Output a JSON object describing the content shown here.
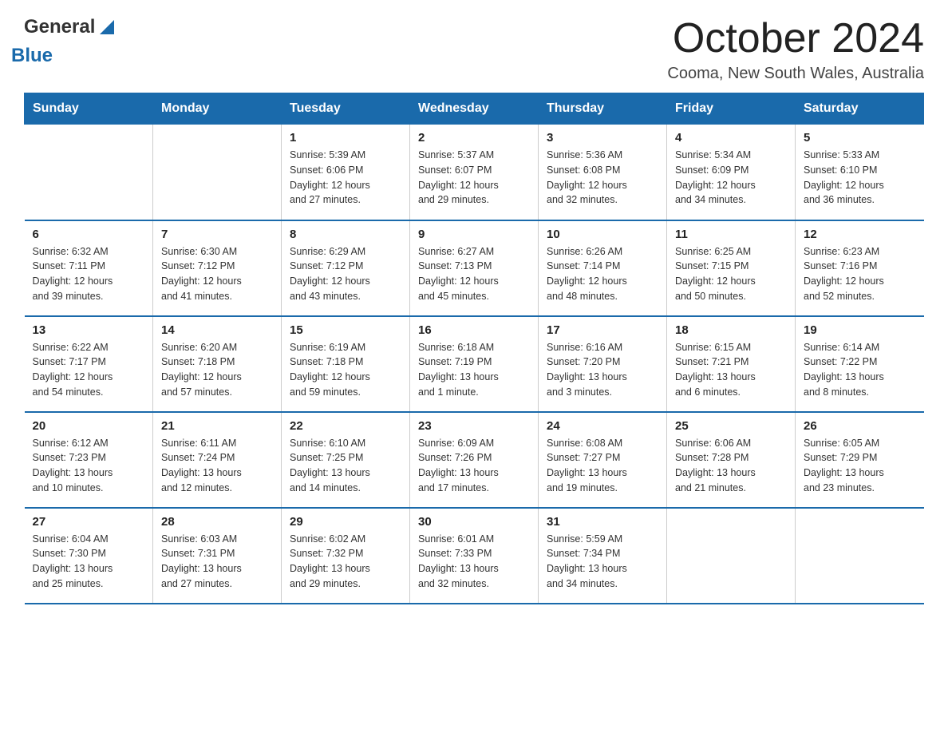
{
  "logo": {
    "general": "General",
    "blue": "Blue"
  },
  "title": "October 2024",
  "location": "Cooma, New South Wales, Australia",
  "days_of_week": [
    "Sunday",
    "Monday",
    "Tuesday",
    "Wednesday",
    "Thursday",
    "Friday",
    "Saturday"
  ],
  "weeks": [
    [
      {
        "day": "",
        "info": ""
      },
      {
        "day": "",
        "info": ""
      },
      {
        "day": "1",
        "info": "Sunrise: 5:39 AM\nSunset: 6:06 PM\nDaylight: 12 hours\nand 27 minutes."
      },
      {
        "day": "2",
        "info": "Sunrise: 5:37 AM\nSunset: 6:07 PM\nDaylight: 12 hours\nand 29 minutes."
      },
      {
        "day": "3",
        "info": "Sunrise: 5:36 AM\nSunset: 6:08 PM\nDaylight: 12 hours\nand 32 minutes."
      },
      {
        "day": "4",
        "info": "Sunrise: 5:34 AM\nSunset: 6:09 PM\nDaylight: 12 hours\nand 34 minutes."
      },
      {
        "day": "5",
        "info": "Sunrise: 5:33 AM\nSunset: 6:10 PM\nDaylight: 12 hours\nand 36 minutes."
      }
    ],
    [
      {
        "day": "6",
        "info": "Sunrise: 6:32 AM\nSunset: 7:11 PM\nDaylight: 12 hours\nand 39 minutes."
      },
      {
        "day": "7",
        "info": "Sunrise: 6:30 AM\nSunset: 7:12 PM\nDaylight: 12 hours\nand 41 minutes."
      },
      {
        "day": "8",
        "info": "Sunrise: 6:29 AM\nSunset: 7:12 PM\nDaylight: 12 hours\nand 43 minutes."
      },
      {
        "day": "9",
        "info": "Sunrise: 6:27 AM\nSunset: 7:13 PM\nDaylight: 12 hours\nand 45 minutes."
      },
      {
        "day": "10",
        "info": "Sunrise: 6:26 AM\nSunset: 7:14 PM\nDaylight: 12 hours\nand 48 minutes."
      },
      {
        "day": "11",
        "info": "Sunrise: 6:25 AM\nSunset: 7:15 PM\nDaylight: 12 hours\nand 50 minutes."
      },
      {
        "day": "12",
        "info": "Sunrise: 6:23 AM\nSunset: 7:16 PM\nDaylight: 12 hours\nand 52 minutes."
      }
    ],
    [
      {
        "day": "13",
        "info": "Sunrise: 6:22 AM\nSunset: 7:17 PM\nDaylight: 12 hours\nand 54 minutes."
      },
      {
        "day": "14",
        "info": "Sunrise: 6:20 AM\nSunset: 7:18 PM\nDaylight: 12 hours\nand 57 minutes."
      },
      {
        "day": "15",
        "info": "Sunrise: 6:19 AM\nSunset: 7:18 PM\nDaylight: 12 hours\nand 59 minutes."
      },
      {
        "day": "16",
        "info": "Sunrise: 6:18 AM\nSunset: 7:19 PM\nDaylight: 13 hours\nand 1 minute."
      },
      {
        "day": "17",
        "info": "Sunrise: 6:16 AM\nSunset: 7:20 PM\nDaylight: 13 hours\nand 3 minutes."
      },
      {
        "day": "18",
        "info": "Sunrise: 6:15 AM\nSunset: 7:21 PM\nDaylight: 13 hours\nand 6 minutes."
      },
      {
        "day": "19",
        "info": "Sunrise: 6:14 AM\nSunset: 7:22 PM\nDaylight: 13 hours\nand 8 minutes."
      }
    ],
    [
      {
        "day": "20",
        "info": "Sunrise: 6:12 AM\nSunset: 7:23 PM\nDaylight: 13 hours\nand 10 minutes."
      },
      {
        "day": "21",
        "info": "Sunrise: 6:11 AM\nSunset: 7:24 PM\nDaylight: 13 hours\nand 12 minutes."
      },
      {
        "day": "22",
        "info": "Sunrise: 6:10 AM\nSunset: 7:25 PM\nDaylight: 13 hours\nand 14 minutes."
      },
      {
        "day": "23",
        "info": "Sunrise: 6:09 AM\nSunset: 7:26 PM\nDaylight: 13 hours\nand 17 minutes."
      },
      {
        "day": "24",
        "info": "Sunrise: 6:08 AM\nSunset: 7:27 PM\nDaylight: 13 hours\nand 19 minutes."
      },
      {
        "day": "25",
        "info": "Sunrise: 6:06 AM\nSunset: 7:28 PM\nDaylight: 13 hours\nand 21 minutes."
      },
      {
        "day": "26",
        "info": "Sunrise: 6:05 AM\nSunset: 7:29 PM\nDaylight: 13 hours\nand 23 minutes."
      }
    ],
    [
      {
        "day": "27",
        "info": "Sunrise: 6:04 AM\nSunset: 7:30 PM\nDaylight: 13 hours\nand 25 minutes."
      },
      {
        "day": "28",
        "info": "Sunrise: 6:03 AM\nSunset: 7:31 PM\nDaylight: 13 hours\nand 27 minutes."
      },
      {
        "day": "29",
        "info": "Sunrise: 6:02 AM\nSunset: 7:32 PM\nDaylight: 13 hours\nand 29 minutes."
      },
      {
        "day": "30",
        "info": "Sunrise: 6:01 AM\nSunset: 7:33 PM\nDaylight: 13 hours\nand 32 minutes."
      },
      {
        "day": "31",
        "info": "Sunrise: 5:59 AM\nSunset: 7:34 PM\nDaylight: 13 hours\nand 34 minutes."
      },
      {
        "day": "",
        "info": ""
      },
      {
        "day": "",
        "info": ""
      }
    ]
  ]
}
